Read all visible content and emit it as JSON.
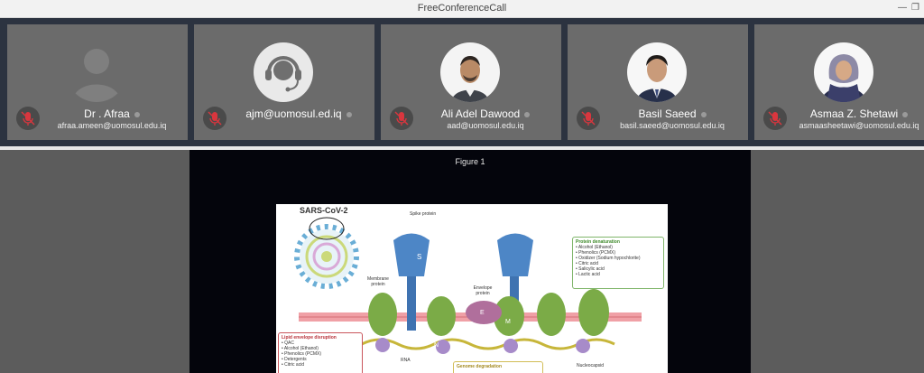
{
  "window": {
    "title": "FreeConferenceCall"
  },
  "participants": [
    {
      "name": "Dr . Afraa",
      "email": "afraa.ameen@uomosul.edu.iq",
      "avatar": "person-silhouette"
    },
    {
      "name": "ajm@uomosul.ed.iq",
      "email": "",
      "avatar": "headset"
    },
    {
      "name": "Ali Adel Dawood",
      "email": "aad@uomosul.edu.iq",
      "avatar": "photo"
    },
    {
      "name": "Basil Saeed",
      "email": "basil.saeed@uomosul.edu.iq",
      "avatar": "photo"
    },
    {
      "name": "Asmaa Z. Shetawi",
      "email": "asmaasheetawi@uomosul.edu.iq",
      "avatar": "photo"
    }
  ],
  "presentation": {
    "figure_title": "Figure 1",
    "figure": {
      "title": "SARS-CoV-2",
      "labels": {
        "spike": "Spike protein",
        "membrane": "Membrane protein",
        "envelope": "Envelope protein",
        "rna": "RNA",
        "nucleocapsid": "Nucleocapsid",
        "s": "S",
        "e": "E",
        "m": "M",
        "n": "N"
      },
      "protein_box": {
        "title": "Protein denaturation",
        "items": [
          "Alcohol (Ethanol)",
          "Phenolics (PCMX)",
          "Oxidizer (Sodium hypochlorite)",
          "Citric acid",
          "Salicylic acid",
          "Lactic acid"
        ]
      },
      "lipid_box": {
        "title": "Lipid envelope disruption",
        "items": [
          "QAC",
          "Alcohol (Ethanol)",
          "Phenolics (PCMX)",
          "Detergents",
          "Citric acid"
        ]
      },
      "genome_box": {
        "title": "Genome degradation"
      }
    }
  }
}
